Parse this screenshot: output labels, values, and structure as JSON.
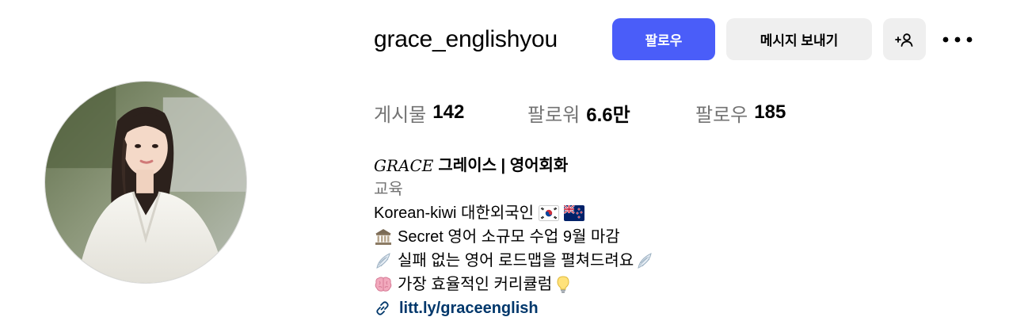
{
  "profile": {
    "username": "grace_englishyou",
    "follow_label": "팔로우",
    "message_label": "메시지 보내기",
    "suggest_icon": "add-person-icon",
    "more_icon": "more-options-icon"
  },
  "stats": {
    "posts_label": "게시물",
    "posts_value": "142",
    "followers_label": "팔로워",
    "followers_value": "6.6만",
    "following_label": "팔로우",
    "following_value": "185"
  },
  "bio": {
    "name_styled": "GRACE",
    "name_rest": "그레이스 | 영어회화",
    "category": "교육",
    "line1": "Korean-kiwi 대한외국인",
    "line2": "Secret 영어 소규모 수업 9월 마감",
    "line3": "실패 없는 영어 로드맵을 펼쳐드려요",
    "line4": "가장 효율적인 커리큘럼",
    "link": "litt.ly/graceenglish"
  },
  "colors": {
    "follow_button": "#4a5df9",
    "secondary_button": "#efefef",
    "muted_text": "#737373",
    "link_text": "#00376b"
  }
}
